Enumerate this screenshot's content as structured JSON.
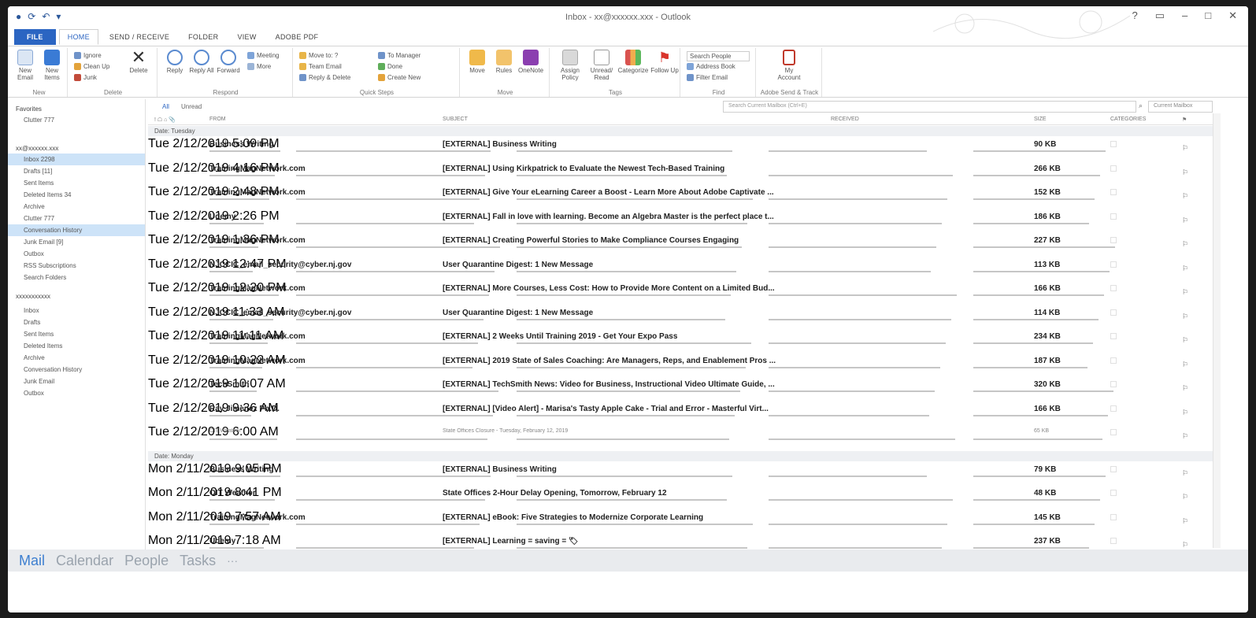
{
  "window": {
    "title": "Inbox - xx@xxxxxx.xxx - Outlook"
  },
  "ribbon_tabs": [
    {
      "label": "FILE"
    },
    {
      "label": "HOME"
    },
    {
      "label": "SEND / RECEIVE"
    },
    {
      "label": "FOLDER"
    },
    {
      "label": "VIEW"
    },
    {
      "label": "ADOBE PDF"
    }
  ],
  "ribbon": {
    "new_email": "New Email",
    "new_items": "New Items",
    "group_new": "New",
    "ignore": "Ignore",
    "clean_up": "Clean Up",
    "junk": "Junk",
    "delete": "Delete",
    "group_delete": "Delete",
    "reply": "Reply",
    "reply_all": "Reply All",
    "forward": "Forward",
    "meeting": "Meeting",
    "more": "More",
    "group_respond": "Respond",
    "qs_move_to": "Move to: ?",
    "qs_team_email": "Team Email",
    "qs_reply_delete": "Reply & Delete",
    "qs_to_manager": "To Manager",
    "qs_done": "Done",
    "qs_create_new": "Create New",
    "group_quick_steps": "Quick Steps",
    "move": "Move",
    "rules": "Rules",
    "onenote": "OneNote",
    "group_move": "Move",
    "assign_policy": "Assign Policy",
    "unread_read": "Unread/ Read",
    "categorize": "Categorize",
    "follow_up": "Follow Up",
    "group_tags": "Tags",
    "search_people": "Search People",
    "address_book": "Address Book",
    "filter_email": "Filter Email",
    "group_find": "Find",
    "my_account": "My Account",
    "group_account": "Adobe Send & Track"
  },
  "left_pane": {
    "favorites_header": "Favorites",
    "favorites": [
      "Clutter 777"
    ],
    "account1_header": "xx@xxxxxx.xxx",
    "account1_folders": [
      {
        "label": "Inbox 2298",
        "selected": true
      },
      {
        "label": "Drafts [11]",
        "selected": false
      },
      {
        "label": "Sent Items",
        "selected": false
      },
      {
        "label": "Deleted Items 34",
        "selected": false
      },
      {
        "label": "Archive",
        "selected": false
      },
      {
        "label": "Clutter 777",
        "selected": false
      },
      {
        "label": "Conversation History",
        "selected": true
      },
      {
        "label": "Junk Email [9]",
        "selected": false
      },
      {
        "label": "Outbox",
        "selected": false
      },
      {
        "label": "RSS Subscriptions",
        "selected": false
      },
      {
        "label": "Search Folders",
        "selected": false
      }
    ],
    "account2_header": "xxxxxxxxxxx",
    "account2_folders": [
      {
        "label": "Inbox"
      },
      {
        "label": "Drafts"
      },
      {
        "label": "Sent Items"
      },
      {
        "label": "Deleted Items"
      },
      {
        "label": "Archive"
      },
      {
        "label": "Conversation History"
      },
      {
        "label": "Junk Email"
      },
      {
        "label": "Outbox"
      }
    ]
  },
  "message_list": {
    "filter_all": "All",
    "filter_unread": "Unread",
    "search_placeholder": "Search Current Mailbox (Ctrl+E)",
    "search_scope": "Current Mailbox",
    "columns": {
      "from": "FROM",
      "subject": "SUBJECT",
      "received": "RECEIVED",
      "size": "SIZE",
      "categories": "CATEGORIES"
    },
    "groups": [
      {
        "label": "Date: Tuesday",
        "messages": [
          {
            "from": "Business Writing",
            "subject": "[EXTERNAL] Business Writing",
            "received": "Tue 2/12/2019 5:09 PM",
            "size": "90 KB"
          },
          {
            "from": "TrainingMagNetwork.com",
            "subject": "[EXTERNAL] Using Kirkpatrick to Evaluate the Newest Tech-Based Training",
            "received": "Tue 2/12/2019 4:16 PM",
            "size": "266 KB"
          },
          {
            "from": "TrainingMagNetwork.com",
            "subject": "[EXTERNAL] Give Your eLearning Career a Boost - Learn More About Adobe Captivate ...",
            "received": "Tue 2/12/2019 2:48 PM",
            "size": "152 KB"
          },
          {
            "from": "Udemy",
            "subject": "[EXTERNAL] Fall in love with learning. Become an Algebra Master is the perfect place t...",
            "received": "Tue 2/12/2019 2:26 PM",
            "size": "186 KB"
          },
          {
            "from": "TrainingMagNetwork.com",
            "subject": "[EXTERNAL] Creating Powerful Stories to Make Compliance Courses Engaging",
            "received": "Tue 2/12/2019 1:36 PM",
            "size": "227 KB"
          },
          {
            "from": "NJCCIC_email_security@cyber.nj.gov",
            "subject": "User Quarantine Digest: 1 New Message",
            "received": "Tue 2/12/2019 12:47 PM",
            "size": "113 KB"
          },
          {
            "from": "TrainingMagNetwork.com",
            "subject": "[EXTERNAL] More Courses, Less Cost: How to Provide More Content on a Limited Bud...",
            "received": "Tue 2/12/2019 12:20 PM",
            "size": "166 KB"
          },
          {
            "from": "NJCCIC_email_security@cyber.nj.gov",
            "subject": "User Quarantine Digest: 1 New Message",
            "received": "Tue 2/12/2019 11:33 AM",
            "size": "114 KB"
          },
          {
            "from": "TrainingMagNetwork.com",
            "subject": "[EXTERNAL] 2 Weeks Until Training 2019 - Get Your Expo Pass",
            "received": "Tue 2/12/2019 11:11 AM",
            "size": "234 KB"
          },
          {
            "from": "TrainingMagNetwork.com",
            "subject": "[EXTERNAL] 2019 State of Sales Coaching: Are Managers, Reps, and Enablement Pros ...",
            "received": "Tue 2/12/2019 10:22 AM",
            "size": "187 KB"
          },
          {
            "from": "TechSmith",
            "subject": "[EXTERNAL] TechSmith News: Video for Business, Instructional Video Ultimate Guide, ...",
            "received": "Tue 2/12/2019 10:07 AM",
            "size": "320 KB"
          },
          {
            "from": "Ray Jimenez Ph.D.",
            "subject": "[EXTERNAL] [Video Alert] - Marisa's Tasty Apple Cake - Trial and Error - Masterful Virt...",
            "received": "Tue 2/12/2019 9:36 AM",
            "size": "166 KB"
          },
          {
            "from": "OIT Weather",
            "subject": "State Offices Closure - Tuesday, February 12, 2019",
            "received": "Tue 2/12/2019 6:00 AM",
            "size": "65 KB",
            "read": true
          }
        ]
      },
      {
        "label": "Date: Monday",
        "messages": [
          {
            "from": "Business Writing",
            "subject": "[EXTERNAL] Business Writing",
            "received": "Mon 2/11/2019 9:05 PM",
            "size": "79 KB"
          },
          {
            "from": "OIT Weather",
            "subject": "State Offices 2-Hour Delay Opening, Tomorrow, February 12",
            "received": "Mon 2/11/2019 8:41 PM",
            "size": "48 KB"
          },
          {
            "from": "TrainingMagNetwork.com",
            "subject": "[EXTERNAL] eBook: Five Strategies to Modernize Corporate Learning",
            "received": "Mon 2/11/2019 7:57 AM",
            "size": "145 KB"
          },
          {
            "from": "Udemy",
            "subject": "[EXTERNAL] Learning = saving = 🏷",
            "received": "Mon 2/11/2019 7:18 AM",
            "size": "237 KB"
          }
        ]
      }
    ]
  },
  "bottom_nav": {
    "mail": "Mail",
    "calendar": "Calendar",
    "people": "People",
    "tasks": "Tasks",
    "more": "···"
  },
  "colors": {
    "accent": "#2b65c2",
    "selected_folder": "#cde3f8",
    "nav_active": "#3d7fd0"
  }
}
